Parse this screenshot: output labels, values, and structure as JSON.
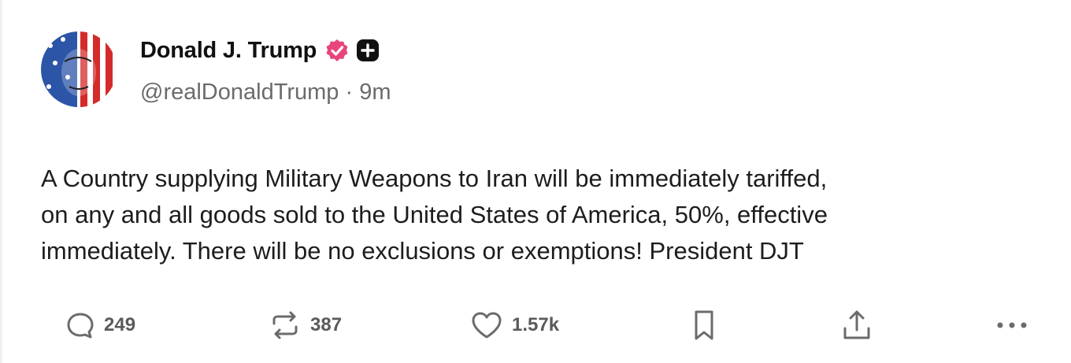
{
  "post": {
    "author": {
      "display_name": "Donald J. Trump",
      "handle": "@realDonaldTrump",
      "time_ago": "9m",
      "separator": "·",
      "badges": [
        "verified-badge-icon",
        "plus-badge-icon"
      ]
    },
    "text": "A Country supplying Military Weapons to Iran will be immediately tariffed,\non any and all goods sold to the United States of America, 50%, effective\nimmediately. There will be no exclusions or exemptions! President DJT",
    "actions": {
      "replies": "249",
      "reposts": "387",
      "likes": "1.57k"
    }
  },
  "colors": {
    "verified": "#e8457a",
    "icon": "#6b6b6b",
    "text": "#1d1d1d",
    "muted": "#6b6b6b"
  }
}
